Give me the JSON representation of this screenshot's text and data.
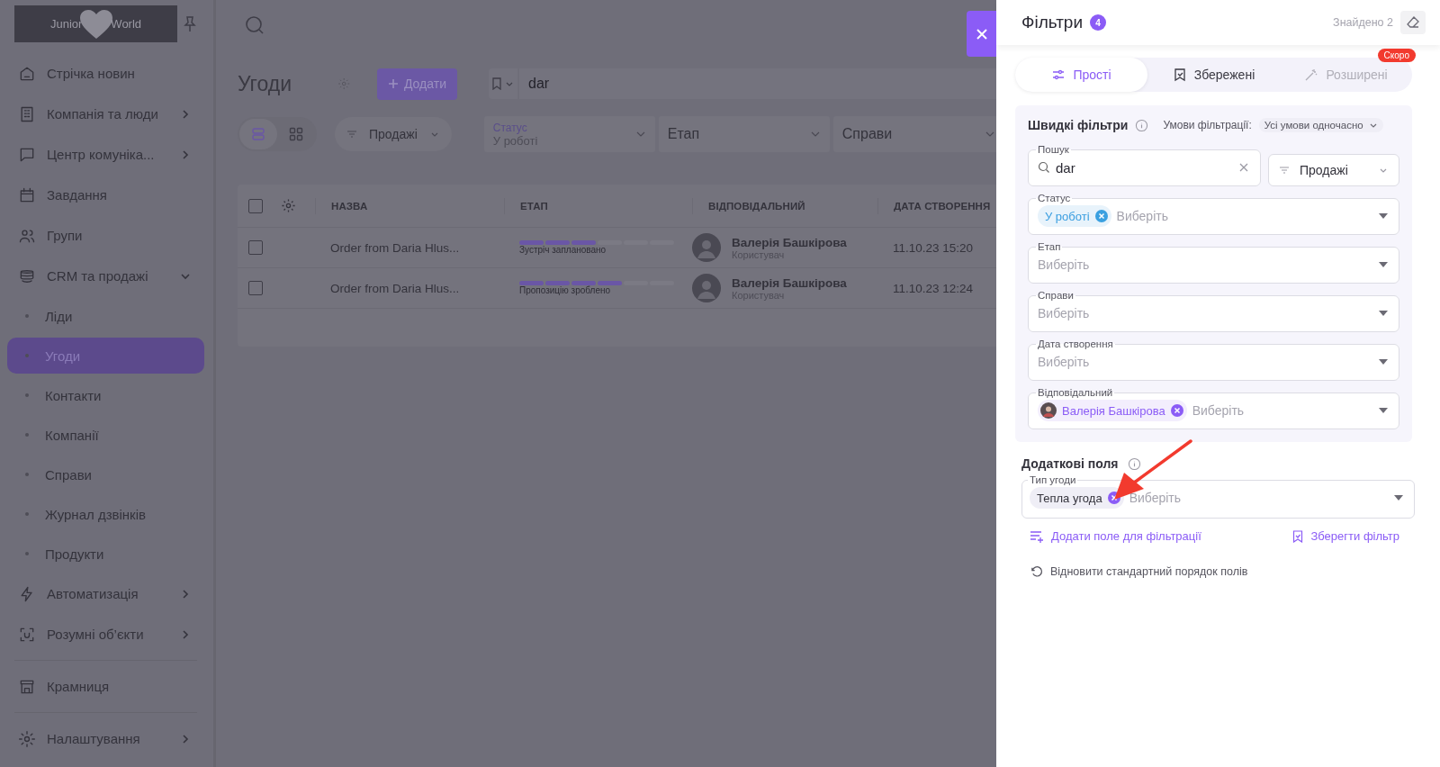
{
  "sidebar": {
    "logo": {
      "left": "Junior",
      "right": "World"
    },
    "sections": [
      {
        "items": [
          {
            "label": "Стрічка новин",
            "selected": false
          },
          {
            "label": "Компанія та люди",
            "selected": false,
            "expanded": false
          },
          {
            "label": "Центр комуніка...",
            "selected": false,
            "expanded": false
          },
          {
            "label": "Завдання",
            "selected": false
          },
          {
            "label": "Групи",
            "selected": false
          },
          {
            "label": "CRM та продажі",
            "selected": false,
            "expanded": true,
            "children": [
              {
                "label": "Ліди",
                "selected": false
              },
              {
                "label": "Угоди",
                "selected": true
              },
              {
                "label": "Контакти",
                "selected": false
              },
              {
                "label": "Компанії",
                "selected": false
              },
              {
                "label": "Справи",
                "selected": false
              },
              {
                "label": "Журнал дзвінків",
                "selected": false
              },
              {
                "label": "Продукти",
                "selected": false
              }
            ]
          },
          {
            "label": "Автоматизація",
            "selected": false,
            "expanded": false
          },
          {
            "label": "Розумні об’єкти",
            "selected": false,
            "expanded": false
          }
        ]
      },
      {
        "items": [
          {
            "label": "Крамниця",
            "selected": false
          }
        ]
      },
      {
        "items": [
          {
            "label": "Налаштування",
            "selected": false,
            "expanded": false
          }
        ]
      }
    ]
  },
  "page": {
    "title": "Угоди",
    "add_button": "Додати",
    "search": {
      "value": "dar"
    },
    "views": [
      {
        "selected": true
      },
      {
        "selected": false
      }
    ],
    "pipeline": "Продажі",
    "filters": [
      {
        "label": "Статус",
        "value": "У роботі"
      },
      {
        "label": "Етап"
      },
      {
        "label": "Справи"
      }
    ]
  },
  "table": {
    "all_checked": false,
    "columns": [
      "НАЗВА",
      "ЕТАП",
      "ВІДПОВІДАЛЬНИЙ",
      "ДАТА СТВОРЕННЯ"
    ],
    "rows": [
      {
        "checked": false,
        "name": "Order from Daria Hlus...",
        "level": 0.5,
        "stage": "Зустріч заплановано",
        "person": "Валерія Башкірова",
        "role": "Користувач",
        "date": "11.10.23 15:20"
      },
      {
        "checked": false,
        "name": "Order from Daria Hlus...",
        "level": 0.667,
        "stage": "Пропозицію зроблено",
        "person": "Валерія Башкірова",
        "role": "Користувач",
        "date": "11.10.23 12:24"
      }
    ]
  },
  "filter_panel": {
    "title": "Фільтри",
    "count": "4",
    "found": "Знайдено 2",
    "tabs": [
      {
        "label": "Прості",
        "selected": true,
        "disabled": false
      },
      {
        "label": "Збережені",
        "selected": false,
        "disabled": false
      },
      {
        "label": "Розширені",
        "selected": false,
        "disabled": true,
        "badge": "Скоро"
      }
    ],
    "quick": {
      "title": "Швидкі фільтри",
      "condition_label": "Умови фільтрації:",
      "condition_value": "Усі умови одночасно",
      "search": {
        "label": "Пошук",
        "value": "dar"
      },
      "pipeline": "Продажі",
      "fields": [
        {
          "label": "Статус",
          "tags": [
            {
              "kind": "status",
              "text": "У роботі"
            }
          ],
          "placeholder": "Виберіть"
        },
        {
          "label": "Етап",
          "placeholder": "Виберіть"
        },
        {
          "label": "Справи",
          "placeholder": "Виберіть"
        },
        {
          "label": "Дата створення",
          "placeholder": "Виберіть"
        },
        {
          "label": "Відповідальний",
          "tags": [
            {
              "kind": "person",
              "text": "Валерія Башкірова"
            }
          ],
          "placeholder": "Виберіть"
        }
      ]
    },
    "extra": {
      "title": "Додаткові поля",
      "fields": [
        {
          "label": "Тип угоди",
          "tags": [
            {
              "kind": "plain",
              "text": "Тепла угода"
            }
          ],
          "placeholder": "Виберіть"
        }
      ]
    },
    "add_field_link": "Додати поле для фільтрації",
    "save_link": "Зберегти фільтр",
    "restore_link": "Відновити стандартний порядок полів"
  }
}
